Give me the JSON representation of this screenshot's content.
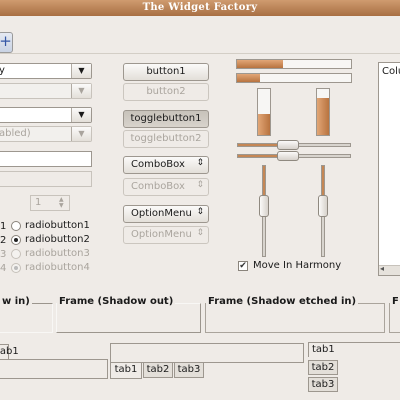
{
  "window": {
    "title": "The Widget Factory"
  },
  "toolbar": {
    "button_icon": "add-icon",
    "button_glyph": "+"
  },
  "combos": [
    {
      "text": "y"
    },
    {
      "text": ""
    },
    {
      "text": ""
    },
    {
      "text": "abled)"
    }
  ],
  "spin": {
    "value": "1",
    "arrows": "▲▼"
  },
  "buttons": {
    "button1": "button1",
    "button2": "button2",
    "togglebutton1": "togglebutton1",
    "togglebutton2": "togglebutton2",
    "combobox": "ComboBox",
    "combobox_disabled": "ComboBox",
    "optionmenu": "OptionMenu",
    "optionmenu_disabled": "OptionMenu"
  },
  "arrow_glyph": "▼",
  "spin_glyph": "⇕",
  "check_glyph": "✔",
  "radios": [
    {
      "prefix": "1",
      "label": "radiobutton1"
    },
    {
      "prefix": "2",
      "label": "radiobutton2"
    },
    {
      "prefix": "3",
      "label": "radiobutton3"
    },
    {
      "prefix": "4",
      "label": "radiobutton4"
    }
  ],
  "progress": {
    "h1": 0.4,
    "h2": 0.2,
    "v1": 0.45,
    "v2": 0.8
  },
  "sliders": {
    "h1": 0.45,
    "h2": 0.45,
    "v1": 0.45,
    "v2": 0.45
  },
  "harmony": {
    "label": "Move In Harmony",
    "checked": true
  },
  "list": {
    "column": "Colu"
  },
  "frames": {
    "shadow_in": "w in)",
    "shadow_out": "Frame (Shadow out)",
    "shadow_etched_in": "Frame (Shadow etched in)",
    "last": "F"
  },
  "tabs": {
    "left": [
      "tab1"
    ],
    "middle": [
      "tab1",
      "tab2",
      "tab3"
    ],
    "right": [
      "tab1",
      "tab2",
      "tab3"
    ]
  },
  "colors": {
    "accent": "#b8733f",
    "title_bar": "#b88459"
  }
}
